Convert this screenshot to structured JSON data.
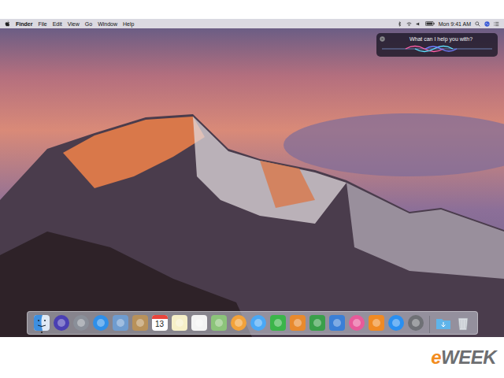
{
  "menu_bar": {
    "app": "Finder",
    "menus": [
      "File",
      "Edit",
      "View",
      "Go",
      "Window",
      "Help"
    ],
    "clock": "Mon 9:41 AM"
  },
  "siri": {
    "prompt": "What can I help you with?"
  },
  "dock": {
    "apps": [
      {
        "kind": "finder",
        "color": "#3d8fe0",
        "running": true
      },
      {
        "kind": "round",
        "color": "#4a3fb3",
        "running": false
      },
      {
        "kind": "round",
        "color": "#8a8f99",
        "running": false
      },
      {
        "kind": "round",
        "color": "#2f8fe8",
        "running": false
      },
      {
        "kind": "square",
        "color": "#6f9ccf",
        "running": false
      },
      {
        "kind": "square",
        "color": "#b8915a",
        "running": false
      },
      {
        "kind": "calendar",
        "color": "#ffffff",
        "label": "13",
        "running": false
      },
      {
        "kind": "square",
        "color": "#f6f0c8",
        "running": false
      },
      {
        "kind": "square",
        "color": "#f4f4f4",
        "running": false
      },
      {
        "kind": "square",
        "color": "#8cc47a",
        "running": false
      },
      {
        "kind": "round",
        "color": "#f2a23a",
        "running": false
      },
      {
        "kind": "round",
        "color": "#4aa8f5",
        "running": false
      },
      {
        "kind": "square",
        "color": "#3bb54a",
        "running": false
      },
      {
        "kind": "square",
        "color": "#e88a2e",
        "running": false
      },
      {
        "kind": "square",
        "color": "#3a9f4a",
        "running": false
      },
      {
        "kind": "square",
        "color": "#3b7fd6",
        "running": false
      },
      {
        "kind": "round",
        "color": "#e85a9a",
        "running": false
      },
      {
        "kind": "square",
        "color": "#f08a24",
        "running": false
      },
      {
        "kind": "round",
        "color": "#2a8ff0",
        "running": false
      },
      {
        "kind": "round",
        "color": "#6e7075",
        "running": false
      },
      {
        "kind": "folder",
        "color": "#5fb4ea",
        "running": false
      },
      {
        "kind": "trash",
        "color": "#d9dde2",
        "running": false
      }
    ]
  },
  "watermark": "eWEEK"
}
